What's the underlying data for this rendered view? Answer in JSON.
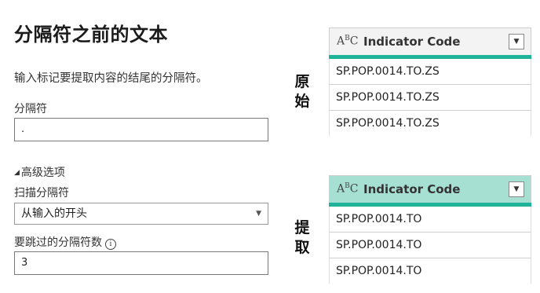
{
  "dialog": {
    "title": "分隔符之前的文本",
    "description": "输入标记要提取内容的结尾的分隔符。",
    "delimiter_label": "分隔符",
    "delimiter_value": ".",
    "advanced_label": "高级选项",
    "scan_label": "扫描分隔符",
    "scan_value": "从输入的开头",
    "skip_label": "要跳过的分隔符数",
    "skip_value": "3"
  },
  "side_labels": {
    "original": [
      "原",
      "始"
    ],
    "extracted": [
      "提",
      "取"
    ]
  },
  "original_table": {
    "type_icon_main": "A",
    "type_icon_sup": "B",
    "type_icon_tail": "C",
    "column": "Indicator Code",
    "rows": [
      "SP.POP.0014.TO.ZS",
      "SP.POP.0014.TO.ZS",
      "SP.POP.0014.TO.ZS"
    ]
  },
  "extracted_table": {
    "type_icon_main": "A",
    "type_icon_sup": "B",
    "type_icon_tail": "C",
    "column": "Indicator Code",
    "rows": [
      "SP.POP.0014.TO",
      "SP.POP.0014.TO",
      "SP.POP.0014.TO"
    ]
  },
  "colors": {
    "accent_teal": "#1fb39a",
    "header_highlight": "#a5e0d3"
  }
}
